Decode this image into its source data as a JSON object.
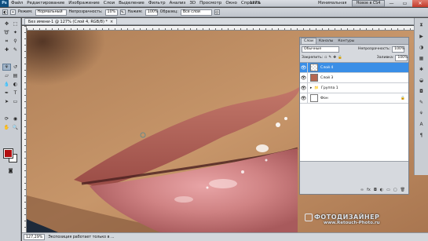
{
  "app": {
    "logo": "Ps",
    "menu": [
      "Файл",
      "Редактирование",
      "Изображение",
      "Слои",
      "Выделение",
      "Фильтр",
      "Анализ",
      "3D",
      "Просмотр",
      "Окно",
      "Справка"
    ],
    "zoom": "127%",
    "workspace_label": "Минимальная",
    "workspace_button": "Новое в CS4",
    "window_controls": [
      "—",
      "▭",
      "✕"
    ]
  },
  "options": {
    "mode_label": "Режим:",
    "mode_value": "Нормальный",
    "opacity_label": "Непрозрачность:",
    "opacity_value": "10%",
    "flow_label": "Нажим:",
    "flow_value": "100%",
    "sample_label": "Образец:",
    "sample_value": "Все слои"
  },
  "document": {
    "tab_title": "Без имени-1 @ 127% (Слой 4, RGB/8) *",
    "status_zoom": "127,29%",
    "status_text": "Экспозиция работает только в ..."
  },
  "colors": {
    "foreground": "#b20e10",
    "background": "#ffffff",
    "accent": "#3a8ee6"
  },
  "layers_panel": {
    "tabs": [
      "Слои",
      "Каналы",
      "Контуры"
    ],
    "blend_mode": "Обычные",
    "opacity_label": "Непрозрачность:",
    "opacity_value": "100%",
    "lock_label": "Закрепить:",
    "fill_label": "Заливка:",
    "fill_value": "100%",
    "layers": [
      {
        "name": "Слой 4",
        "selected": true
      },
      {
        "name": "Слой 3",
        "selected": false
      },
      {
        "name": "Группа 1",
        "selected": false
      },
      {
        "name": "Фон",
        "selected": false
      }
    ]
  },
  "watermark": {
    "title": "ФОТОДИЗАЙНЕР",
    "url": "www.Retouch-Photo.ru"
  }
}
